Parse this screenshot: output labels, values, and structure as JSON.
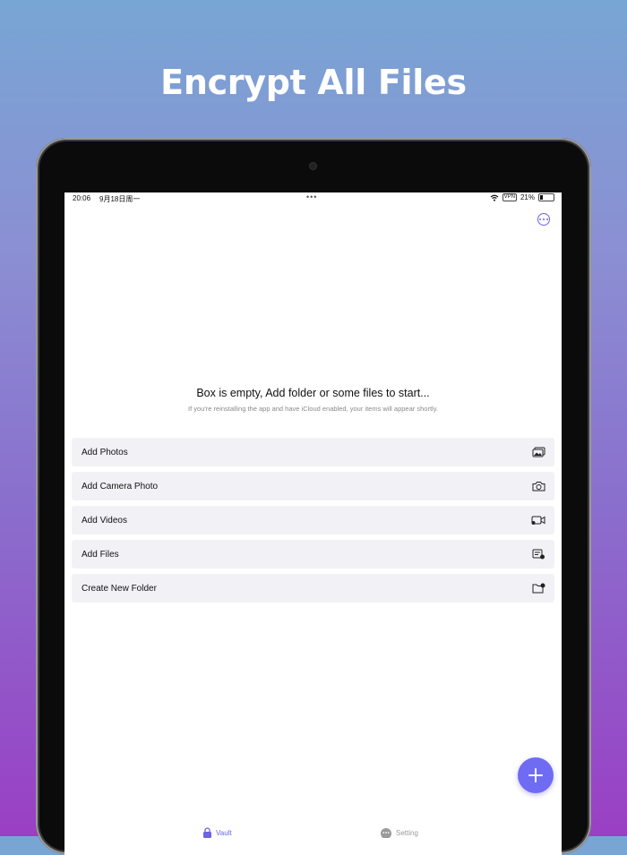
{
  "headline": "Encrypt All Files",
  "status_bar": {
    "time": "20:06",
    "date": "9月18日周一",
    "dots": "•••",
    "vpn": "VPN",
    "battery": "21%"
  },
  "empty_state": {
    "title": "Box is empty, Add folder or some files to start...",
    "subtitle": "If you're reinstalling the app and have iCloud enabled, your items will appear shortly."
  },
  "actions": [
    {
      "label": "Add Photos",
      "icon": "photos-icon"
    },
    {
      "label": "Add Camera Photo",
      "icon": "camera-icon"
    },
    {
      "label": "Add Videos",
      "icon": "video-icon"
    },
    {
      "label": "Add Files",
      "icon": "add-file-icon"
    },
    {
      "label": "Create New Folder",
      "icon": "new-folder-icon"
    }
  ],
  "tabs": {
    "vault": "Vault",
    "setting": "Setting"
  },
  "colors": {
    "accent": "#6f6bf2",
    "action_bg": "#f2f2f6"
  }
}
